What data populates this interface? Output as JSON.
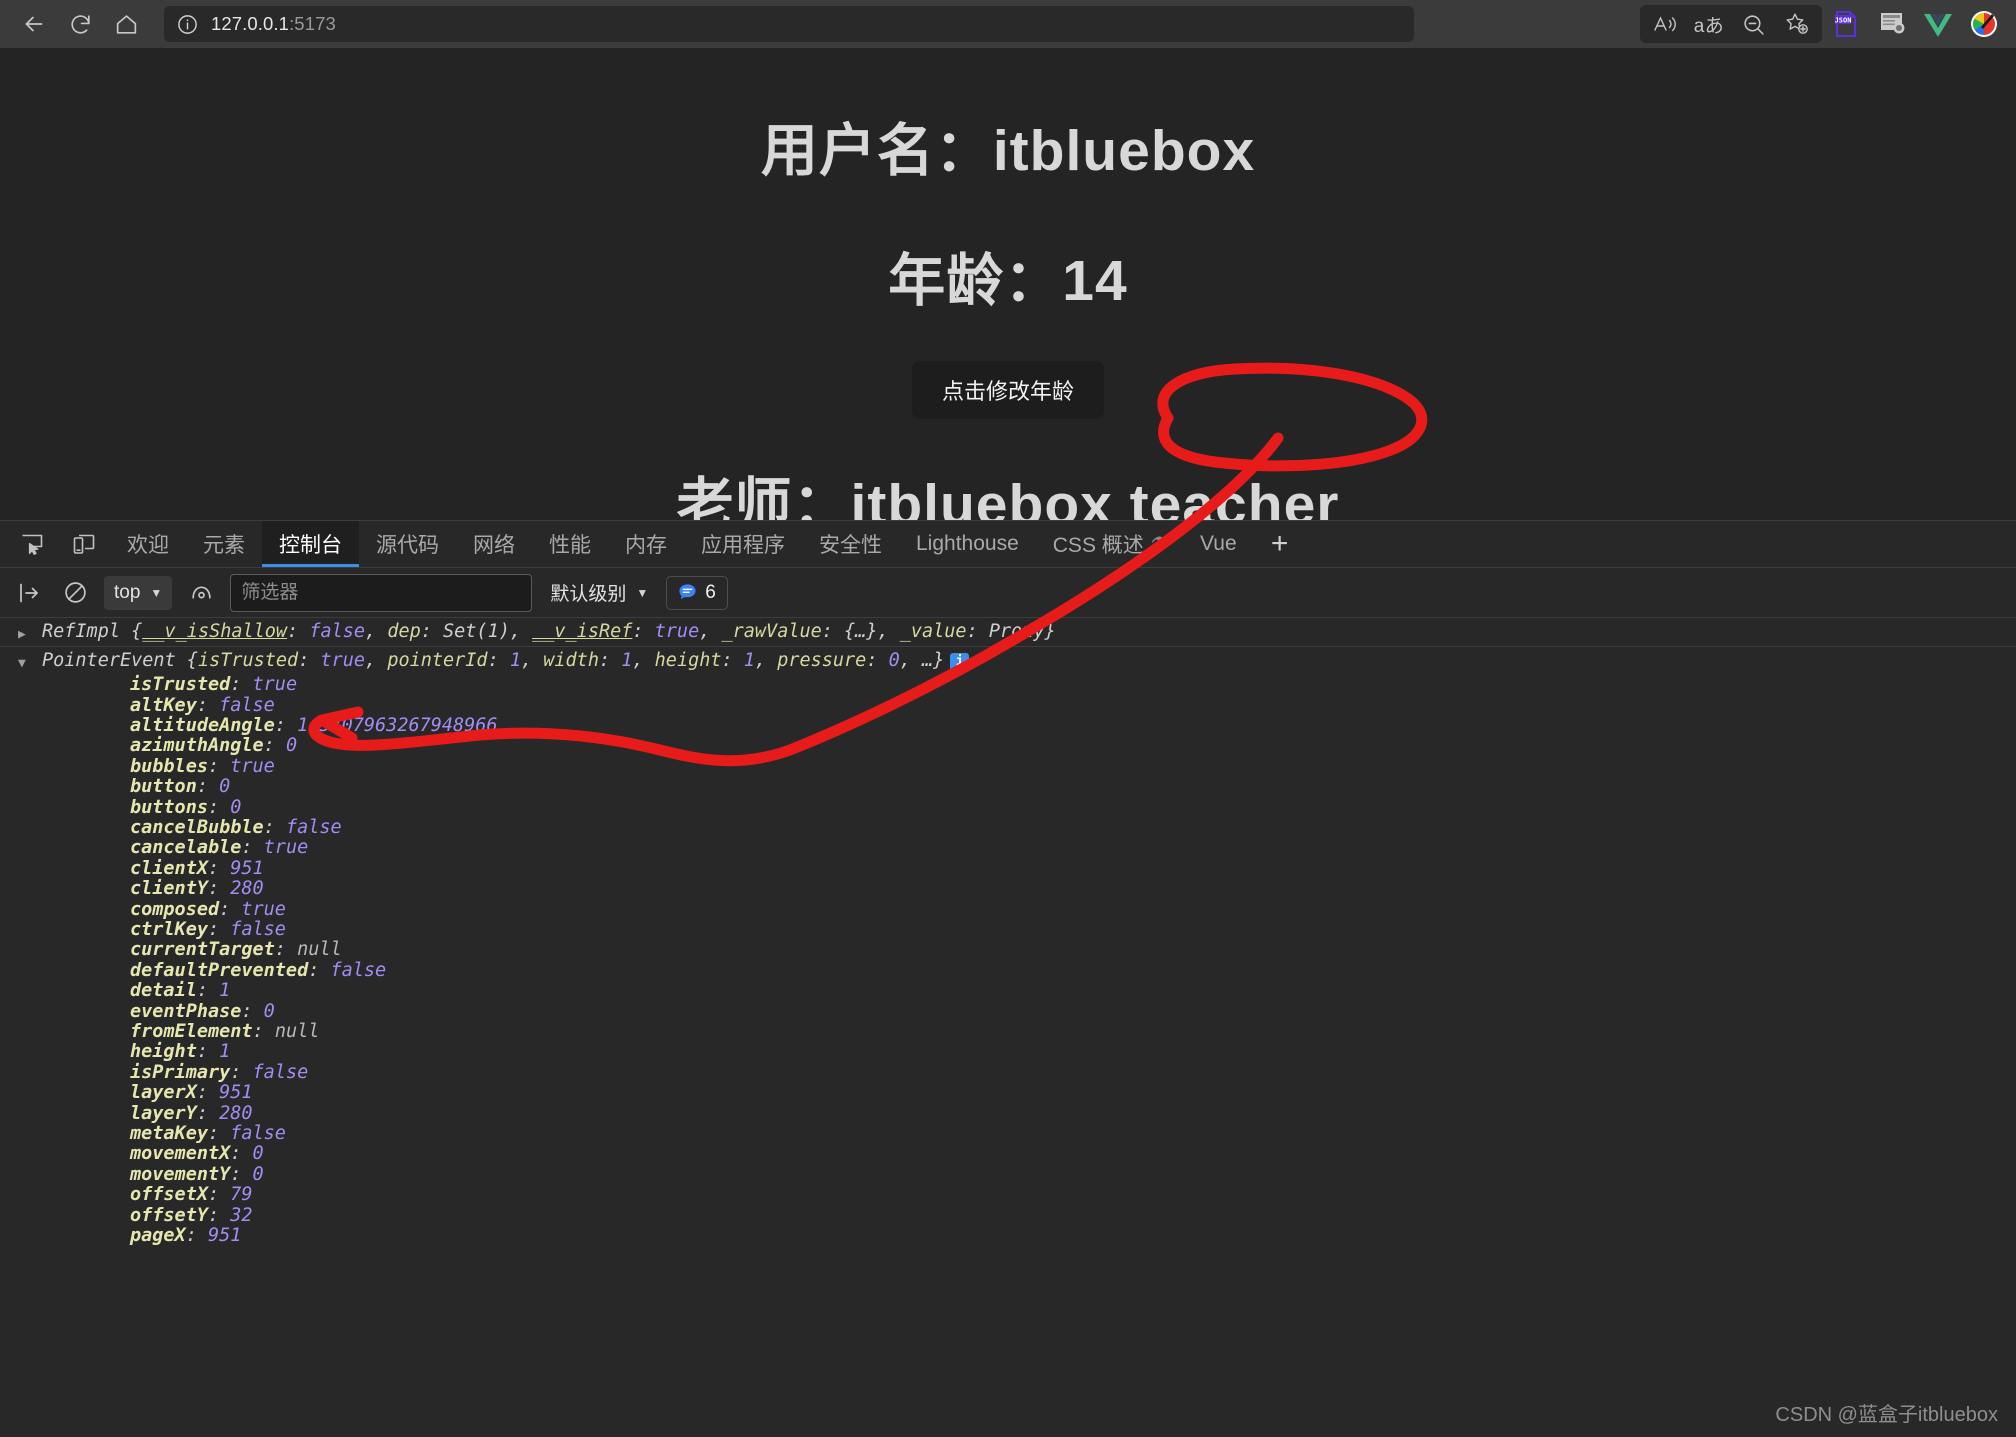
{
  "browser": {
    "nav": [
      {
        "name": "back-button",
        "icon": "arrow-left-icon"
      },
      {
        "name": "reload-button",
        "icon": "reload-icon"
      },
      {
        "name": "home-button",
        "icon": "home-icon"
      }
    ],
    "address": {
      "info_icon": "site-info-icon",
      "host": "127.0.0.1",
      "port": ":5173"
    },
    "toolbar_icons": [
      {
        "name": "read-aloud-icon",
        "glyph": "A"
      },
      {
        "name": "translate-icon",
        "glyph": "aあ"
      },
      {
        "name": "zoom-out-icon",
        "glyph": "search-minus"
      },
      {
        "name": "favorite-add-icon",
        "glyph": "star-plus"
      },
      {
        "name": "json-viewer-extension-icon",
        "glyph": "JSON"
      },
      {
        "name": "extension-icon",
        "glyph": "page-bug"
      },
      {
        "name": "vue-devtools-extension-icon",
        "glyph": "V"
      },
      {
        "name": "color-picker-extension-icon",
        "glyph": "palette"
      }
    ]
  },
  "page": {
    "username_line": "用户名：itbluebox",
    "age_line": "年龄：14",
    "change_age_button": "点击修改年龄",
    "teacher_line": "老师：itbluebox teacher"
  },
  "devtools": {
    "tool_icons": [
      {
        "name": "inspect-element-icon"
      },
      {
        "name": "device-toolbar-icon"
      }
    ],
    "tabs": [
      {
        "label": "欢迎",
        "active": false,
        "flask": false
      },
      {
        "label": "元素",
        "active": false,
        "flask": false
      },
      {
        "label": "控制台",
        "active": true,
        "flask": false
      },
      {
        "label": "源代码",
        "active": false,
        "flask": false
      },
      {
        "label": "网络",
        "active": false,
        "flask": false
      },
      {
        "label": "性能",
        "active": false,
        "flask": false
      },
      {
        "label": "内存",
        "active": false,
        "flask": false
      },
      {
        "label": "应用程序",
        "active": false,
        "flask": false
      },
      {
        "label": "安全性",
        "active": false,
        "flask": false
      },
      {
        "label": "Lighthouse",
        "active": false,
        "flask": false
      },
      {
        "label": "CSS 概述",
        "active": false,
        "flask": true
      },
      {
        "label": "Vue",
        "active": false,
        "flask": false
      }
    ],
    "add_tab_label": "+",
    "console_toolbar": {
      "clear_console_icon": "clear-console-icon",
      "no_entry_icon": "no-entry-icon",
      "context_value": "top",
      "eye_icon": "live-expression-icon",
      "filter_placeholder": "筛选器",
      "filter_value": "",
      "level_label": "默认级别",
      "message_count": "6"
    },
    "log": {
      "row1": {
        "disclosure": "collapsed",
        "name": "RefImpl",
        "open_brace": "{",
        "entries": [
          {
            "key": "__v_isShallow",
            "underline": true,
            "value": "false",
            "vtype": "kw"
          },
          {
            "key": "dep",
            "underline": false,
            "value": "Set(1)",
            "vtype": "plain"
          },
          {
            "key": "__v_isRef",
            "underline": true,
            "value": "true",
            "vtype": "kw"
          },
          {
            "key": "_rawValue",
            "underline": false,
            "value": "{…}",
            "vtype": "plain"
          },
          {
            "key": "_value",
            "underline": false,
            "value": "Proxy",
            "vtype": "plain"
          }
        ],
        "close_brace": "}"
      },
      "row2": {
        "disclosure": "expanded",
        "name": "PointerEvent",
        "open_brace": "{",
        "entries": [
          {
            "key": "isTrusted",
            "underline": false,
            "value": "true",
            "vtype": "kw"
          },
          {
            "key": "pointerId",
            "underline": false,
            "value": "1",
            "vtype": "num"
          },
          {
            "key": "width",
            "underline": false,
            "value": "1",
            "vtype": "num"
          },
          {
            "key": "height",
            "underline": false,
            "value": "1",
            "vtype": "num"
          },
          {
            "key": "pressure",
            "underline": false,
            "value": "0",
            "vtype": "num"
          }
        ],
        "ellipsis": "…",
        "close_brace": "}",
        "info_badge": "i"
      },
      "properties": [
        {
          "key": "isTrusted",
          "value": "true",
          "vtype": "bool",
          "own": true
        },
        {
          "key": "altKey",
          "value": "false",
          "vtype": "bool",
          "own": false
        },
        {
          "key": "altitudeAngle",
          "value": "1.5707963267948966",
          "vtype": "num",
          "own": false
        },
        {
          "key": "azimuthAngle",
          "value": "0",
          "vtype": "num",
          "own": false
        },
        {
          "key": "bubbles",
          "value": "true",
          "vtype": "bool",
          "own": false
        },
        {
          "key": "button",
          "value": "0",
          "vtype": "num",
          "own": false
        },
        {
          "key": "buttons",
          "value": "0",
          "vtype": "num",
          "own": false
        },
        {
          "key": "cancelBubble",
          "value": "false",
          "vtype": "bool",
          "own": false
        },
        {
          "key": "cancelable",
          "value": "true",
          "vtype": "bool",
          "own": false
        },
        {
          "key": "clientX",
          "value": "951",
          "vtype": "num",
          "own": false
        },
        {
          "key": "clientY",
          "value": "280",
          "vtype": "num",
          "own": false
        },
        {
          "key": "composed",
          "value": "true",
          "vtype": "bool",
          "own": false
        },
        {
          "key": "ctrlKey",
          "value": "false",
          "vtype": "bool",
          "own": false
        },
        {
          "key": "currentTarget",
          "value": "null",
          "vtype": "null",
          "own": false
        },
        {
          "key": "defaultPrevented",
          "value": "false",
          "vtype": "bool",
          "own": false
        },
        {
          "key": "detail",
          "value": "1",
          "vtype": "num",
          "own": false
        },
        {
          "key": "eventPhase",
          "value": "0",
          "vtype": "num",
          "own": false
        },
        {
          "key": "fromElement",
          "value": "null",
          "vtype": "null",
          "own": false
        },
        {
          "key": "height",
          "value": "1",
          "vtype": "num",
          "own": false
        },
        {
          "key": "isPrimary",
          "value": "false",
          "vtype": "bool",
          "own": false
        },
        {
          "key": "layerX",
          "value": "951",
          "vtype": "num",
          "own": false
        },
        {
          "key": "layerY",
          "value": "280",
          "vtype": "num",
          "own": false
        },
        {
          "key": "metaKey",
          "value": "false",
          "vtype": "bool",
          "own": false
        },
        {
          "key": "movementX",
          "value": "0",
          "vtype": "num",
          "own": false
        },
        {
          "key": "movementY",
          "value": "0",
          "vtype": "num",
          "own": false
        },
        {
          "key": "offsetX",
          "value": "79",
          "vtype": "num",
          "own": false
        },
        {
          "key": "offsetY",
          "value": "32",
          "vtype": "num",
          "own": false
        },
        {
          "key": "pageX",
          "value": "951",
          "vtype": "num",
          "own": false
        }
      ]
    }
  },
  "annotation": {
    "color": "#e81b1b",
    "description": "red hand-drawn ellipse around the 点击修改年龄 button with an arrow pointing to the isTrusted line in the console"
  },
  "watermark": "CSDN @蓝盒子itbluebox"
}
